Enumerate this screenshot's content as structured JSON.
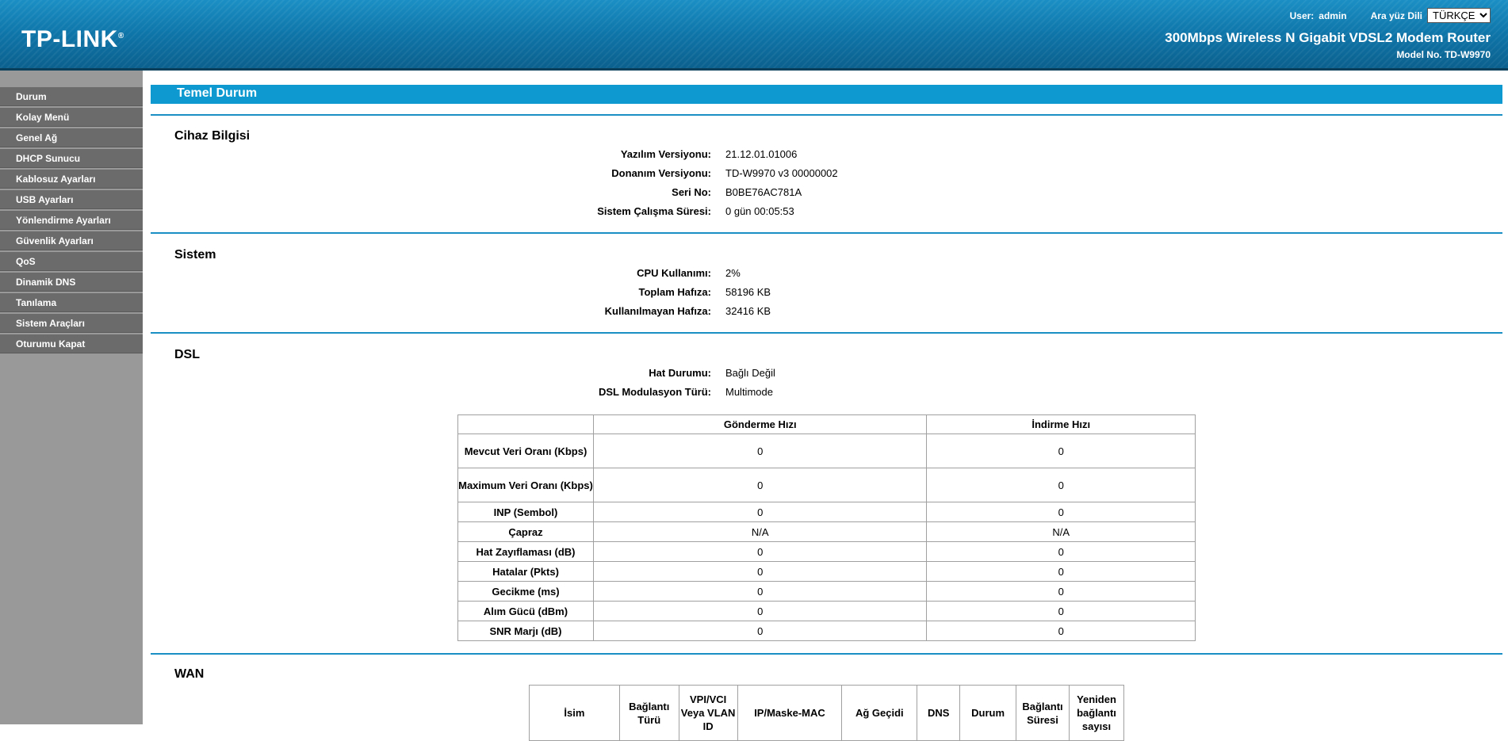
{
  "header": {
    "logo": "TP-LINK",
    "logo_mark": "®",
    "user_label": "User:",
    "user_value": "admin",
    "lang_label": "Ara yüz Dili",
    "lang_selected": "TÜRKÇE",
    "product": "300Mbps Wireless N Gigabit VDSL2 Modem Router",
    "model": "Model No. TD-W9970"
  },
  "sidebar": {
    "items": [
      {
        "label": "Durum"
      },
      {
        "label": "Kolay Menü"
      },
      {
        "label": "Genel Ağ"
      },
      {
        "label": "DHCP Sunucu"
      },
      {
        "label": "Kablosuz Ayarları"
      },
      {
        "label": "USB Ayarları"
      },
      {
        "label": "Yönlendirme Ayarları"
      },
      {
        "label": "Güvenlik Ayarları"
      },
      {
        "label": "QoS"
      },
      {
        "label": "Dinamik DNS"
      },
      {
        "label": "Tanılama"
      },
      {
        "label": "Sistem Araçları"
      },
      {
        "label": "Oturumu Kapat"
      }
    ]
  },
  "page": {
    "title": "Temel Durum"
  },
  "device": {
    "title": "Cihaz Bilgisi",
    "rows": [
      {
        "k": "Yazılım Versiyonu:",
        "v": "21.12.01.01006"
      },
      {
        "k": "Donanım Versiyonu:",
        "v": "TD-W9970 v3 00000002"
      },
      {
        "k": "Seri No:",
        "v": "B0BE76AC781A"
      },
      {
        "k": "Sistem Çalışma Süresi:",
        "v": "0 gün 00:05:53"
      }
    ]
  },
  "system": {
    "title": "Sistem",
    "rows": [
      {
        "k": "CPU Kullanımı:",
        "v": "2%"
      },
      {
        "k": "Toplam Hafıza:",
        "v": "58196 KB"
      },
      {
        "k": "Kullanılmayan Hafıza:",
        "v": "32416 KB"
      }
    ]
  },
  "dsl": {
    "title": "DSL",
    "rows": [
      {
        "k": "Hat Durumu:",
        "v": "Bağlı Değil"
      },
      {
        "k": "DSL Modulasyon Türü:",
        "v": "Multimode"
      }
    ],
    "table": {
      "headers": [
        "",
        "Gönderme Hızı",
        "İndirme Hızı"
      ],
      "rows": [
        {
          "label": "Mevcut Veri Oranı (Kbps)",
          "up": "0",
          "down": "0"
        },
        {
          "label": "Maximum Veri Oranı (Kbps)",
          "up": "0",
          "down": "0"
        },
        {
          "label": "INP (Sembol)",
          "up": "0",
          "down": "0"
        },
        {
          "label": "Çapraz",
          "up": "N/A",
          "down": "N/A"
        },
        {
          "label": "Hat Zayıflaması (dB)",
          "up": "0",
          "down": "0"
        },
        {
          "label": "Hatalar (Pkts)",
          "up": "0",
          "down": "0"
        },
        {
          "label": "Gecikme (ms)",
          "up": "0",
          "down": "0"
        },
        {
          "label": "Alım Gücü (dBm)",
          "up": "0",
          "down": "0"
        },
        {
          "label": "SNR Marjı (dB)",
          "up": "0",
          "down": "0"
        }
      ]
    }
  },
  "wan": {
    "title": "WAN",
    "headers": [
      "İsim",
      "Bağlantı Türü",
      "VPI/VCI Veya VLAN ID",
      "IP/Maske-MAC",
      "Ağ Geçidi",
      "DNS",
      "Durum",
      "Bağlantı Süresi",
      "Yeniden bağlantı sayısı"
    ]
  }
}
